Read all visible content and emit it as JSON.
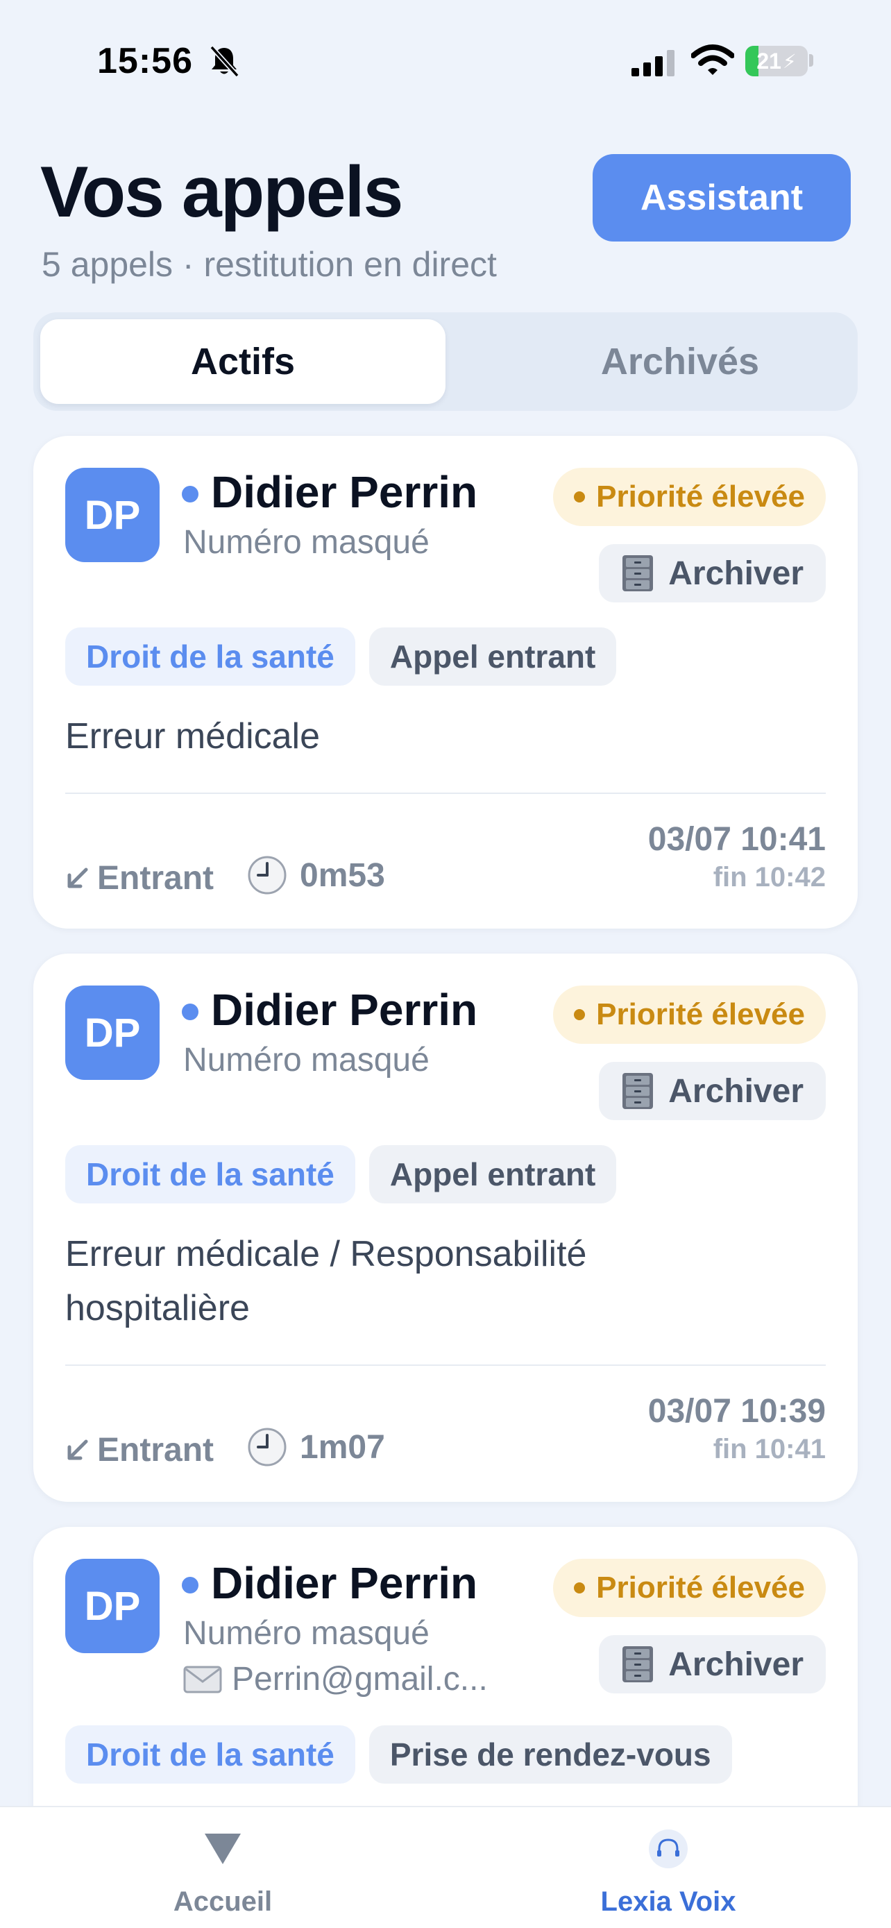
{
  "status_bar": {
    "time": "15:56",
    "battery": "21",
    "battery_level": 0.21
  },
  "header": {
    "title": "Vos appels",
    "subtitle": "5 appels · restitution en direct",
    "assistant_label": "Assistant"
  },
  "segmented": {
    "active_label": "Actifs",
    "archived_label": "Archivés"
  },
  "calls": [
    {
      "initials": "DP",
      "name": "Didier Perrin",
      "number": "Numéro masqué",
      "priority": "Priorité élevée",
      "archive_label": "Archiver",
      "tags": [
        "Droit de la santé",
        "Appel entrant"
      ],
      "summary": "Erreur médicale",
      "direction": "Entrant",
      "duration": "0m53",
      "date": "03/07 10:41",
      "end": "fin 10:42"
    },
    {
      "initials": "DP",
      "name": "Didier Perrin",
      "number": "Numéro masqué",
      "priority": "Priorité élevée",
      "archive_label": "Archiver",
      "tags": [
        "Droit de la santé",
        "Appel entrant"
      ],
      "summary": "Erreur médicale / Responsabilité hospitalière",
      "direction": "Entrant",
      "duration": "1m07",
      "date": "03/07 10:39",
      "end": "fin 10:41"
    },
    {
      "initials": "DP",
      "name": "Didier Perrin",
      "number": "Numéro masqué",
      "email": "Perrin@gmail.c...",
      "priority": "Priorité élevée",
      "archive_label": "Archiver",
      "tags": [
        "Droit de la santé",
        "Prise de rendez-vous"
      ]
    }
  ],
  "tab_bar": {
    "home_label": "Accueil",
    "voice_label": "Lexia Voix"
  },
  "icons": {
    "bell": "bell-slash-icon",
    "signal": "cellular-signal-icon",
    "wifi": "wifi-icon",
    "battery": "battery-charging-icon",
    "archive": "file-cabinet-icon",
    "email": "envelope-icon",
    "direction": "arrow-down-left-icon",
    "duration": "clock-icon",
    "home": "triangle-down-icon",
    "voice": "headset-icon"
  },
  "colors": {
    "accent": "#5b8def",
    "priority": "#c98a12",
    "priority_bg": "#fdf3dc",
    "muted": "#7c8797"
  }
}
